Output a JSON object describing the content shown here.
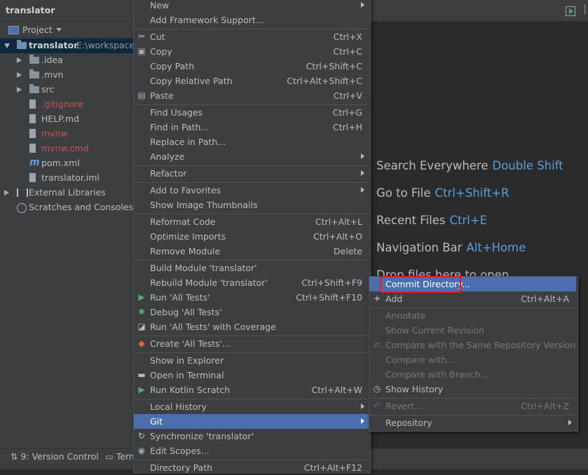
{
  "app": {
    "title": "translator"
  },
  "project_panel": {
    "header": "Project",
    "tree": [
      {
        "label": "translator",
        "path": "E:\\workspace\\",
        "type": "module",
        "expanded": true,
        "level": 0,
        "color": "#d0d0d0"
      },
      {
        "label": ".idea",
        "type": "folder",
        "level": 1,
        "color": "#bbbbbb"
      },
      {
        "label": ".mvn",
        "type": "folder",
        "level": 1,
        "color": "#bbbbbb"
      },
      {
        "label": "src",
        "type": "folder",
        "level": 1,
        "color": "#bbbbbb"
      },
      {
        "label": ".gitignore",
        "type": "file",
        "level": 1,
        "color": "#c75450"
      },
      {
        "label": "HELP.md",
        "type": "file",
        "level": 1,
        "color": "#bbbbbb"
      },
      {
        "label": "mvnw",
        "type": "file",
        "level": 1,
        "color": "#c75450"
      },
      {
        "label": "mvnw.cmd",
        "type": "file",
        "level": 1,
        "color": "#c75450"
      },
      {
        "label": "pom.xml",
        "type": "maven",
        "level": 1,
        "color": "#bbbbbb"
      },
      {
        "label": "translator.iml",
        "type": "file",
        "level": 1,
        "color": "#bbbbbb"
      },
      {
        "label": "External Libraries",
        "type": "libraries",
        "level": 0,
        "color": "#bbbbbb"
      },
      {
        "label": "Scratches and Consoles",
        "type": "scratches",
        "level": 0,
        "color": "#bbbbbb"
      }
    ]
  },
  "bottom_bar": {
    "version_control": "9: Version Control",
    "terminal": "Term"
  },
  "welcome_hints": [
    {
      "text": "Search Everywhere",
      "key": "Double Shift"
    },
    {
      "text": "Go to File",
      "key": "Ctrl+Shift+R"
    },
    {
      "text": "Recent Files",
      "key": "Ctrl+E"
    },
    {
      "text": "Navigation Bar",
      "key": "Alt+Home"
    },
    {
      "text": "Drop files here to open",
      "key": ""
    }
  ],
  "context_menu": {
    "items": [
      {
        "label": "New",
        "shortcut": "",
        "submenu": true,
        "icon": ""
      },
      {
        "label": "Add Framework Support...",
        "shortcut": "",
        "icon": ""
      },
      {
        "sep": true
      },
      {
        "label": "Cut",
        "shortcut": "Ctrl+X",
        "icon": "scissors-icon"
      },
      {
        "label": "Copy",
        "shortcut": "Ctrl+C",
        "icon": "copy-icon"
      },
      {
        "label": "Copy Path",
        "shortcut": "Ctrl+Shift+C",
        "icon": ""
      },
      {
        "label": "Copy Relative Path",
        "shortcut": "Ctrl+Alt+Shift+C",
        "icon": ""
      },
      {
        "label": "Paste",
        "shortcut": "Ctrl+V",
        "icon": "paste-icon"
      },
      {
        "sep": true
      },
      {
        "label": "Find Usages",
        "shortcut": "Ctrl+G",
        "icon": ""
      },
      {
        "label": "Find in Path...",
        "shortcut": "Ctrl+H",
        "icon": ""
      },
      {
        "label": "Replace in Path...",
        "shortcut": "",
        "icon": ""
      },
      {
        "label": "Analyze",
        "shortcut": "",
        "submenu": true,
        "icon": ""
      },
      {
        "sep": true
      },
      {
        "label": "Refactor",
        "shortcut": "",
        "submenu": true,
        "icon": ""
      },
      {
        "sep": true
      },
      {
        "label": "Add to Favorites",
        "shortcut": "",
        "submenu": true,
        "icon": ""
      },
      {
        "label": "Show Image Thumbnails",
        "shortcut": "",
        "icon": ""
      },
      {
        "sep": true
      },
      {
        "label": "Reformat Code",
        "shortcut": "Ctrl+Alt+L",
        "icon": ""
      },
      {
        "label": "Optimize Imports",
        "shortcut": "Ctrl+Alt+O",
        "icon": ""
      },
      {
        "label": "Remove Module",
        "shortcut": "Delete",
        "icon": ""
      },
      {
        "sep": true
      },
      {
        "label": "Build Module 'translator'",
        "shortcut": "",
        "icon": ""
      },
      {
        "label": "Rebuild Module 'translator'",
        "shortcut": "Ctrl+Shift+F9",
        "icon": ""
      },
      {
        "label": "Run 'All Tests'",
        "shortcut": "Ctrl+Shift+F10",
        "icon": "run-icon"
      },
      {
        "label": "Debug 'All Tests'",
        "shortcut": "",
        "icon": "debug-icon"
      },
      {
        "label": "Run 'All Tests' with Coverage",
        "shortcut": "",
        "icon": "coverage-icon"
      },
      {
        "sep": true
      },
      {
        "label": "Create 'All Tests'...",
        "shortcut": "",
        "icon": "create-test-icon"
      },
      {
        "sep": true
      },
      {
        "label": "Show in Explorer",
        "shortcut": "",
        "icon": ""
      },
      {
        "label": "Open in Terminal",
        "shortcut": "",
        "icon": "terminal-icon"
      },
      {
        "label": "Run Kotlin Scratch",
        "shortcut": "Ctrl+Alt+W",
        "icon": "run-icon"
      },
      {
        "sep": true
      },
      {
        "label": "Local History",
        "shortcut": "",
        "submenu": true,
        "icon": ""
      },
      {
        "label": "Git",
        "shortcut": "",
        "submenu": true,
        "highlighted": true,
        "icon": ""
      },
      {
        "label": "Synchronize 'translator'",
        "shortcut": "",
        "icon": "sync-icon"
      },
      {
        "label": "Edit Scopes...",
        "shortcut": "",
        "icon": "scopes-icon"
      },
      {
        "sep": true
      },
      {
        "label": "Directory Path",
        "shortcut": "Ctrl+Alt+F12",
        "icon": ""
      }
    ]
  },
  "git_submenu": {
    "items": [
      {
        "label": "Commit Directory...",
        "shortcut": "",
        "highlighted": true,
        "icon": ""
      },
      {
        "label": "Add",
        "shortcut": "Ctrl+Alt+A",
        "icon": "plus-icon"
      },
      {
        "sep": true
      },
      {
        "label": "Annotate",
        "shortcut": "",
        "disabled": true,
        "icon": ""
      },
      {
        "label": "Show Current Revision",
        "shortcut": "",
        "disabled": true,
        "icon": ""
      },
      {
        "label": "Compare with the Same Repository Version",
        "shortcut": "",
        "disabled": true,
        "icon": "compare-icon"
      },
      {
        "label": "Compare with...",
        "shortcut": "",
        "disabled": true,
        "icon": ""
      },
      {
        "label": "Compare with Branch...",
        "shortcut": "",
        "disabled": true,
        "icon": ""
      },
      {
        "label": "Show History",
        "shortcut": "",
        "icon": "history-icon"
      },
      {
        "sep": true
      },
      {
        "label": "Revert...",
        "shortcut": "Ctrl+Alt+Z",
        "disabled": true,
        "icon": "revert-icon"
      },
      {
        "sep": true
      },
      {
        "label": "Repository",
        "shortcut": "",
        "submenu": true,
        "icon": ""
      }
    ]
  },
  "colors": {
    "highlight": "#4b6eaf",
    "annotation": "#e51b1b",
    "hint_key": "#5c9ddd"
  }
}
